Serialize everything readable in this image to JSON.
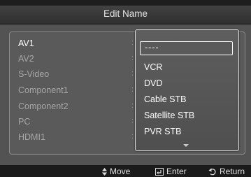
{
  "header": {
    "title": "Edit Name"
  },
  "inputs": [
    {
      "label": "AV1",
      "selected": true
    },
    {
      "label": "AV2",
      "selected": false
    },
    {
      "label": "S-Video",
      "selected": false
    },
    {
      "label": "Component1",
      "selected": false
    },
    {
      "label": "Component2",
      "selected": false
    },
    {
      "label": "PC",
      "selected": false
    },
    {
      "label": "HDMI1",
      "selected": false
    }
  ],
  "dropdown": {
    "selected_value": "----",
    "options": [
      "VCR",
      "DVD",
      "Cable STB",
      "Satellite STB",
      "PVR STB"
    ],
    "more_indicator_icon": "chevron-down-icon"
  },
  "help": {
    "move_label": "Move",
    "enter_label": "Enter",
    "return_label": "Return",
    "move_icon": "up-down-arrow-icon",
    "enter_icon": "enter-icon",
    "return_icon": "return-icon"
  }
}
